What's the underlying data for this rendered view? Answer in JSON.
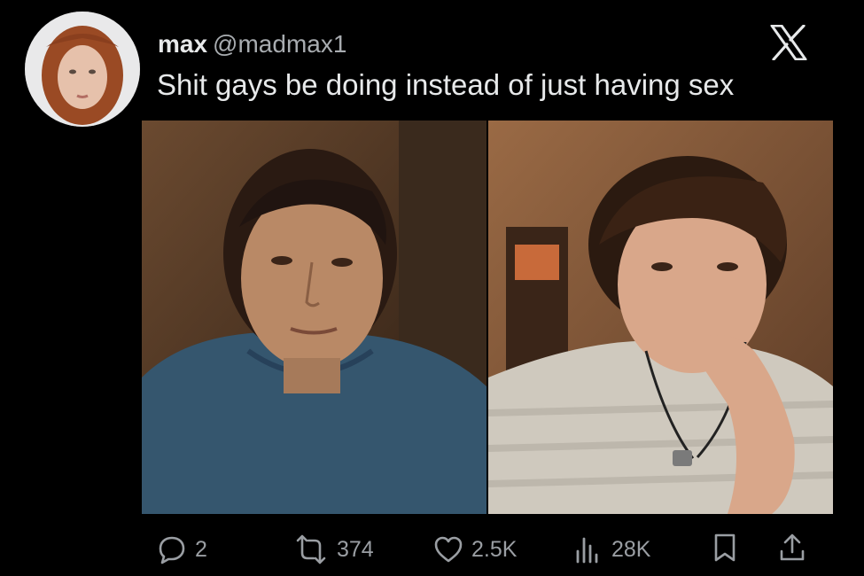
{
  "tweet": {
    "author": {
      "name": "max",
      "handle": "@madmax1",
      "avatar_icon": "avatar-photo"
    },
    "platform_icon": "x-logo-icon",
    "text": "Shit gays be doing instead of just having sex",
    "media": {
      "images": [
        {
          "icon": "photo-left"
        },
        {
          "icon": "photo-right"
        }
      ]
    },
    "actions": {
      "replies": "2",
      "retweets": "374",
      "likes": "2.5K",
      "views": "28K"
    }
  },
  "colors": {
    "background": "#000000",
    "text": "#e7e9ea",
    "secondary": "#9a9ea3"
  }
}
